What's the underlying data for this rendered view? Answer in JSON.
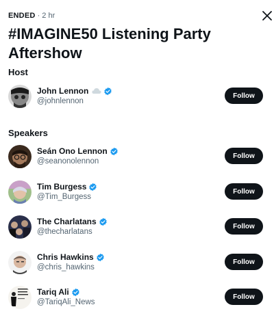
{
  "header": {
    "status": "ENDED",
    "time_ago": "· 2 hr",
    "title": "#IMAGINE50 Listening Party Aftershow"
  },
  "host_section": {
    "label": "Host",
    "host": {
      "name": "John Lennon",
      "handle": "@johnlennon",
      "verified": true,
      "follow_label": "Follow"
    }
  },
  "speakers_section": {
    "label": "Speakers",
    "speakers": [
      {
        "name": "Seán Ono Lennon",
        "handle": "@seanonolennon",
        "verified": true,
        "follow_label": "Follow"
      },
      {
        "name": "Tim Burgess",
        "handle": "@Tim_Burgess",
        "verified": true,
        "follow_label": "Follow"
      },
      {
        "name": "The Charlatans",
        "handle": "@thecharlatans",
        "verified": true,
        "follow_label": "Follow"
      },
      {
        "name": "Chris Hawkins",
        "handle": "@chris_hawkins",
        "verified": true,
        "follow_label": "Follow"
      },
      {
        "name": "Tariq Ali",
        "handle": "@TariqAli_News",
        "verified": true,
        "follow_label": "Follow"
      }
    ]
  },
  "colors": {
    "verified": "#1d9bf0",
    "text": "#0f1419",
    "secondary": "#536471",
    "button": "#0f1419"
  },
  "icons": {
    "close": "close-icon",
    "verified": "verified-badge-icon",
    "cloud": "cloud-icon"
  }
}
